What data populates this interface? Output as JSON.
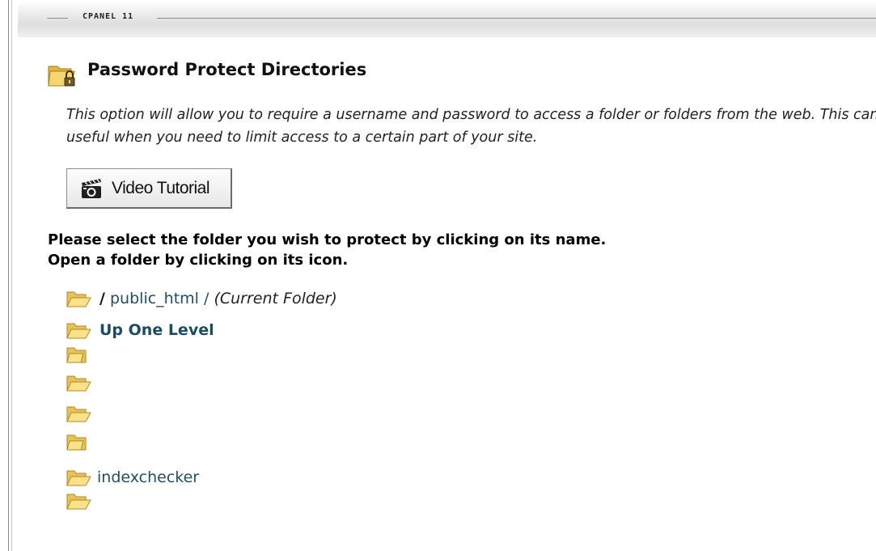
{
  "header": {
    "brand": "CPANEL 11"
  },
  "page": {
    "title": "Password Protect Directories",
    "description_line1": "This option will allow you to require a username and password to access a folder or folders from the web. This can be",
    "description_line2": "useful when you need to limit access to a certain part of your site."
  },
  "video_button": {
    "label": "Video Tutorial",
    "icon": "video-camera-icon"
  },
  "instructions": {
    "line1": "Please select the folder you wish to protect by clicking on its name.",
    "line2": "Open a folder by clicking on its icon."
  },
  "tree": {
    "current_path": {
      "root": "/",
      "folder": "public_html",
      "separator": "/",
      "note": "(Current Folder)"
    },
    "up_one_level": "Up One Level",
    "folder_names": [
      "",
      "",
      "",
      "",
      "indexchecker",
      ""
    ]
  },
  "colors": {
    "link": "#224e68",
    "folder_yellow": "#f3d266",
    "header_band": "#e4e4e4"
  }
}
